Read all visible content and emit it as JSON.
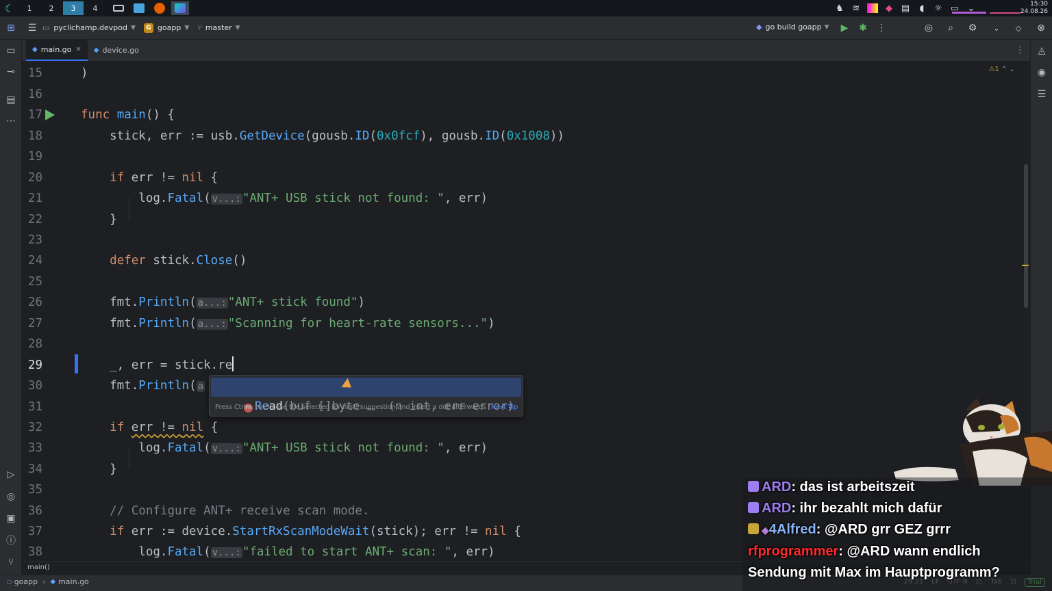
{
  "taskbar": {
    "workspaces": [
      "1",
      "2",
      "3",
      "4"
    ],
    "active_workspace": "3",
    "clock_time": "15:30",
    "clock_date": "24.08.26"
  },
  "header": {
    "project": "pyclichamp.devpod",
    "module_badge": "G",
    "module": "goapp",
    "branch": "master",
    "run_config": "go build goapp"
  },
  "tabs": [
    {
      "label": "main.go",
      "active": true
    },
    {
      "label": "device.go",
      "active": false
    }
  ],
  "editor": {
    "inspection_count": "1",
    "current_line": "29"
  },
  "completion": {
    "typed": "Re",
    "rest": "ad",
    "signature": "(buf []byte",
    "ellipsis": "…",
    "returns": "(n int, err error)",
    "tip": "Press Ctrl+. to choose the selected (or first) suggestion and insert a dot afterwards",
    "next_tip": "Next Tip"
  },
  "structure_crumb": "main()",
  "statusbar": {
    "crumb_module": "goapp",
    "crumb_file": "main.go",
    "position": "29:21",
    "line_sep": "LF",
    "encoding": "UTF-8",
    "indent": "Tab",
    "license": "Trial"
  },
  "chat": [
    {
      "user": "ARD",
      "text": ": das ist arbeitszeit"
    },
    {
      "user": "ARD",
      "text": ": ihr bezahlt mich dafür"
    },
    {
      "user": "4Alfred",
      "text": ": @ARD grr GEZ grrr"
    },
    {
      "user": "rfprogrammer",
      "text": ": @ARD wann endlich"
    },
    {
      "user": "",
      "text": "Sendung mit Max im Hauptprogramm?"
    }
  ],
  "colors": {
    "accent": "#3574f0",
    "editor_bg": "#1e1f22",
    "keyword": "#cf8e6d",
    "string": "#6aab73",
    "number": "#2aacb8"
  }
}
